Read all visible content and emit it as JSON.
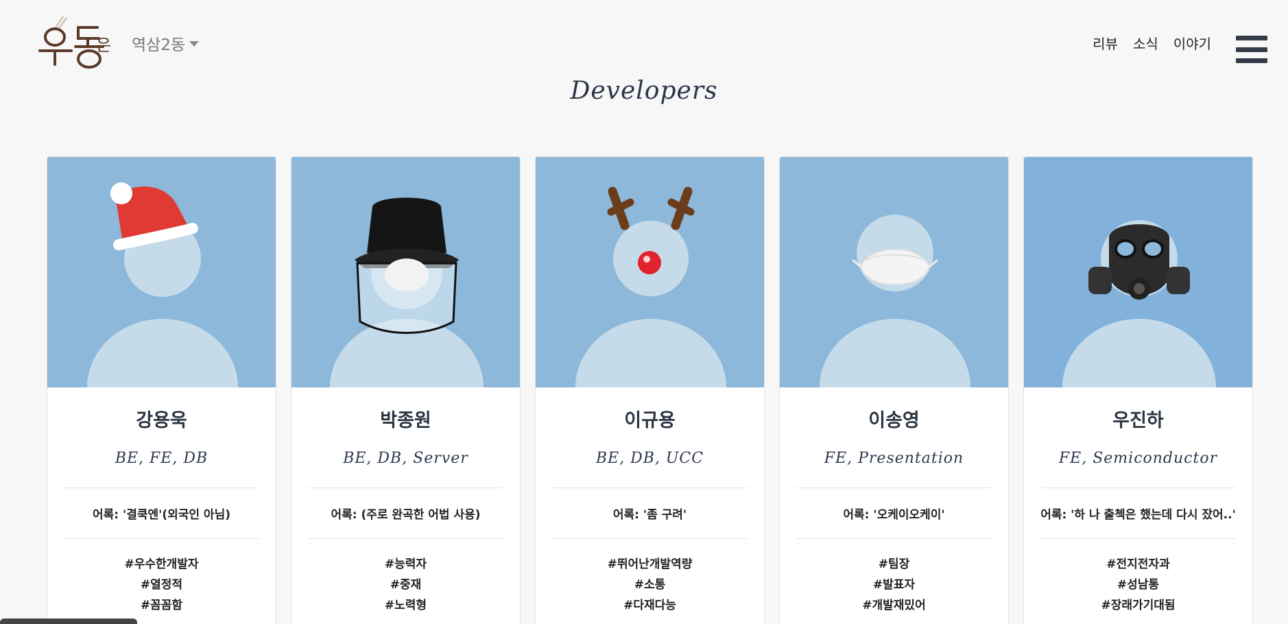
{
  "header": {
    "logo_alt": "우동",
    "logo_suffix": "은",
    "location": "역삼2동",
    "nav": [
      "리뷰",
      "소식",
      "이야기"
    ]
  },
  "title": "Developers",
  "cards": [
    {
      "name": "강용욱",
      "roles": "BE, FE, DB",
      "quote": "어록: '결쿡엔'(외국인 아님)",
      "tags": [
        "#우수한개발자",
        "#열정적",
        "#꼼꼼함"
      ],
      "accessory": "santa-hat"
    },
    {
      "name": "박종원",
      "roles": "BE, DB, Server",
      "quote": "어록: (주로 완곡한 어법 사용)",
      "tags": [
        "#능력자",
        "#중재",
        "#노력형"
      ],
      "accessory": "bucket-hat-face-shield"
    },
    {
      "name": "이규용",
      "roles": "BE, DB, UCC",
      "quote": "어록: '좀 구려'",
      "tags": [
        "#뛰어난개발역량",
        "#소통",
        "#다재다능"
      ],
      "accessory": "reindeer-antlers"
    },
    {
      "name": "이송영",
      "roles": "FE, Presentation",
      "quote": "어록: '오케이오케이'",
      "tags": [
        "#팀장",
        "#발표자",
        "#개발재밌어"
      ],
      "accessory": "face-mask"
    },
    {
      "name": "우진하",
      "roles": "FE, Semiconductor",
      "quote": "어록: '하 나 출첵은 했는데 다시 잤어..'",
      "tags": [
        "#전지전자과",
        "#성남통",
        "#장래가기대됨"
      ],
      "accessory": "gas-mask"
    }
  ],
  "colors": {
    "avatar_bg": "#8db8d9",
    "silhouette": "#c5dbea",
    "logo_brown": "#5b3a29"
  }
}
